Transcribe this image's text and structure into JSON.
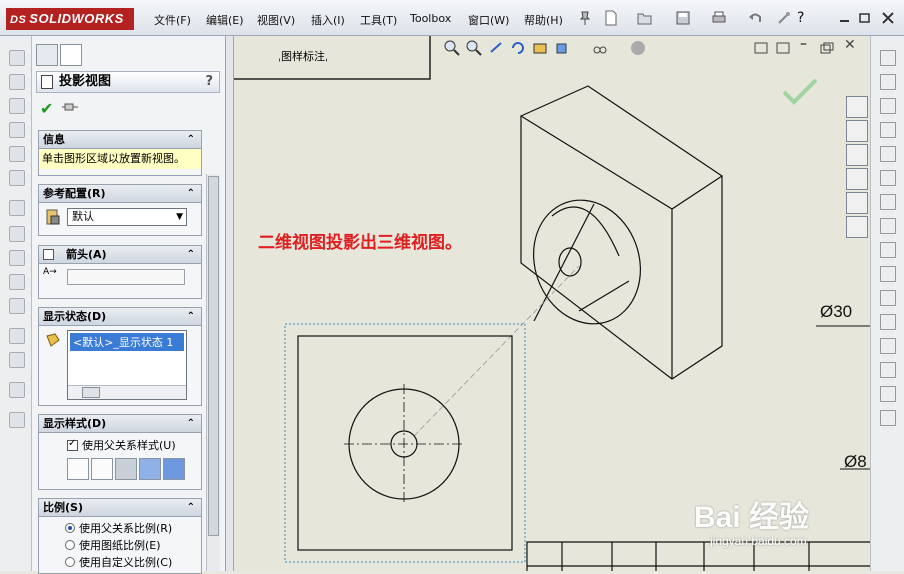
{
  "app": {
    "logo_prefix": "DS",
    "logo_text": "SOLIDWORKS"
  },
  "menu": [
    "文件(F)",
    "编辑(E)",
    "视图(V)",
    "插入(I)",
    "工具(T)",
    "Toolbox",
    "窗口(W)",
    "帮助(H)"
  ],
  "property_manager": {
    "title": "投影视图",
    "help": "?",
    "groups": {
      "info": {
        "label": "信息",
        "message": "单击图形区域以放置新视图。"
      },
      "ref_config": {
        "label": "参考配置(R)",
        "value": "默认"
      },
      "arrow": {
        "label": "箭头(A)",
        "checked": false,
        "prefix": "A→",
        "value": ""
      },
      "display_state": {
        "label": "显示状态(D)",
        "item": "<默认>_显示状态 1"
      },
      "display_style": {
        "label": "显示样式(D)",
        "use_parent": "使用父关系样式(U)",
        "use_parent_checked": true
      },
      "scale": {
        "label": "比例(S)",
        "options": [
          "使用父关系比例(R)",
          "使用图纸比例(E)",
          "使用自定义比例(C)"
        ],
        "selected_index": 0
      }
    }
  },
  "canvas": {
    "sheet_label": "ˌ图样标注ˌ",
    "annotation": "二维视图投影出三维视图。",
    "dimensions": [
      "Ø30",
      "Ø8"
    ],
    "watermark": "Bai 经验",
    "watermark_sub": "jingyan.baidu.com"
  },
  "colors": {
    "annotation": "#e02020",
    "accent": "#b32120",
    "canvas": "#e7e6db",
    "selection": "#3a7bd5",
    "confirm": "#1a9a1a"
  }
}
